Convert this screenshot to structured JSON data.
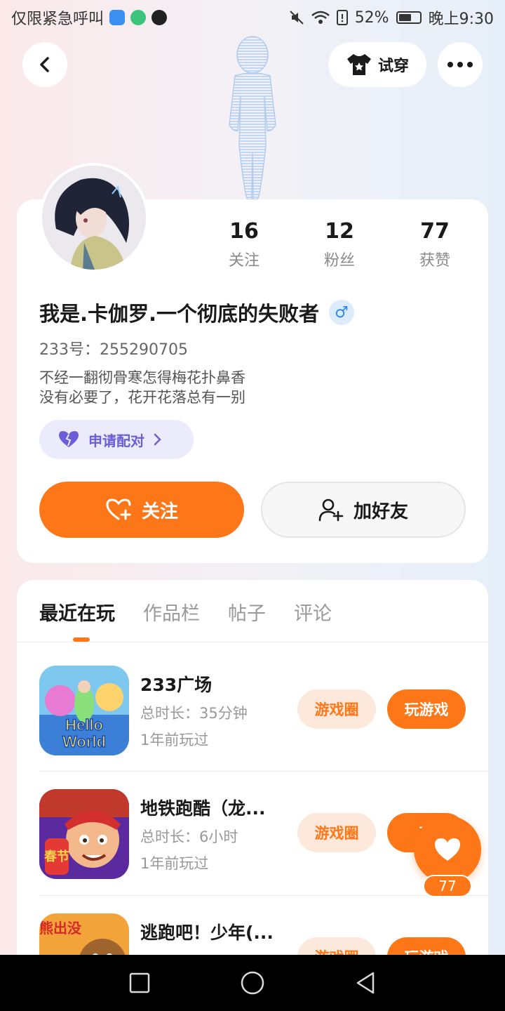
{
  "status_bar": {
    "left_text": "仅限紧急呼叫",
    "battery": "52%",
    "time": "晚上9:30"
  },
  "top_bar": {
    "back_icon": "chevron-left-icon",
    "try_on_label": "试穿",
    "more_icon": "more-dots-icon"
  },
  "profile": {
    "stats": [
      {
        "value": "16",
        "label": "关注"
      },
      {
        "value": "12",
        "label": "粉丝"
      },
      {
        "value": "77",
        "label": "获赞"
      }
    ],
    "username": "我是.卡伽罗.一个彻底的失败者",
    "gender": "♂",
    "user_id": "233号：255290705",
    "bio_line1": "不经一翻彻骨寒怎得梅花扑鼻香",
    "bio_line2": "没有必要了，花开花落总有一别",
    "pair_label": "申请配对",
    "follow_label": "关注",
    "add_friend_label": "加好友"
  },
  "tabs": [
    {
      "label": "最近在玩",
      "active": true
    },
    {
      "label": "作品栏",
      "active": false
    },
    {
      "label": "帖子",
      "active": false
    },
    {
      "label": "评论",
      "active": false
    }
  ],
  "games": [
    {
      "title": "233广场",
      "duration": "总时长：35分钟",
      "last_played": "1年前玩过",
      "circle_label": "游戏圈",
      "play_label": "玩游戏",
      "icon_text": "Hello World"
    },
    {
      "title": "地铁跑酷（龙...",
      "duration": "总时长：6小时",
      "last_played": "1年前玩过",
      "circle_label": "游戏圈",
      "play_label": "玩",
      "icon_text": "春节"
    },
    {
      "title": "逃跑吧！少年(...",
      "circle_label": "游戏圈",
      "play_label": "玩游戏",
      "icon_text": "熊出没"
    }
  ],
  "float_like": {
    "count": "77"
  },
  "colors": {
    "accent": "#fd7617",
    "pair_purple": "#6b5ed8",
    "gender_blue": "#2e8ae6"
  }
}
